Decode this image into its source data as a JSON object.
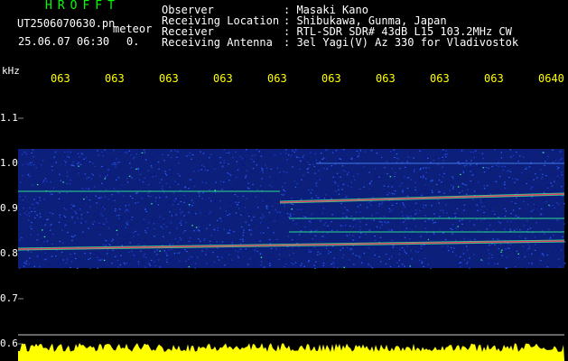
{
  "header": {
    "brand": "HROFFT",
    "filename": "UT2506070630.pn",
    "mode": "meteor",
    "datetime": "25.06.07 06:30",
    "count": "0.",
    "info": [
      {
        "label": "Observer",
        "value": ": Masaki Kano"
      },
      {
        "label": "Receiving Location",
        "value": ": Shibukawa, Gunma, Japan"
      },
      {
        "label": "Receiver",
        "value": ": RTL-SDR SDR# 43dB L15 103.2MHz CW"
      },
      {
        "label": "Receiving Antenna",
        "value": ": 3el Yagi(V) Az 330 for Vladivostok"
      }
    ]
  },
  "axes": {
    "y_unit": "kHz",
    "y_ticks": [
      "1.1",
      "1.0",
      "0.9",
      "0.8",
      "0.7",
      "0.6"
    ],
    "x_ticks": [
      "063",
      "063",
      "063",
      "063",
      "063",
      "063",
      "063",
      "063",
      "063",
      "0640"
    ]
  },
  "colors": {
    "background": "#000000",
    "text": "#ffffff",
    "brand": "#00ff00",
    "time_ticks": "#ffff00",
    "noise_band": "#1530b0",
    "signal_hot": "#ff2060",
    "signal_warm": "#30ff90",
    "amplitude_trace": "#ffff00"
  }
}
